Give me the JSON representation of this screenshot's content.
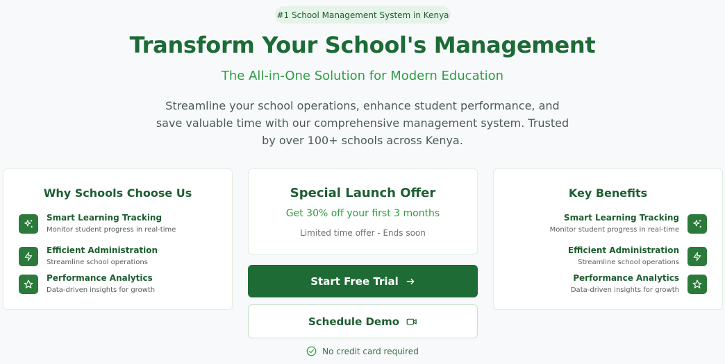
{
  "badge": "#1 School Management System in Kenya",
  "hero": {
    "title": "Transform Your School's Management",
    "subtitle": "The All-in-One Solution for Modern Education",
    "description": "Streamline your school operations, enhance student performance, and save valuable time with our comprehensive management system. Trusted by over 100+ schools across Kenya."
  },
  "why_card": {
    "title": "Why Schools Choose Us",
    "features": [
      {
        "name": "Smart Learning Tracking",
        "desc": "Monitor student progress in real-time",
        "icon": "sparkles-icon"
      },
      {
        "name": "Efficient Administration",
        "desc": "Streamline school operations",
        "icon": "lightning-icon"
      },
      {
        "name": "Performance Analytics",
        "desc": "Data-driven insights for growth",
        "icon": "star-icon"
      }
    ]
  },
  "offer_card": {
    "title": "Special Launch Offer",
    "subtitle": "Get 30% off your first 3 months",
    "note": "Limited time offer - Ends soon"
  },
  "benefits_card": {
    "title": "Key Benefits",
    "features": [
      {
        "name": "Smart Learning Tracking",
        "desc": "Monitor student progress in real-time",
        "icon": "sparkles-icon"
      },
      {
        "name": "Efficient Administration",
        "desc": "Streamline school operations",
        "icon": "lightning-icon"
      },
      {
        "name": "Performance Analytics",
        "desc": "Data-driven insights for growth",
        "icon": "star-icon"
      }
    ]
  },
  "cta": {
    "primary_label": "Start Free Trial",
    "secondary_label": "Schedule Demo",
    "no_credit_card": "No credit card required"
  },
  "colors": {
    "primary": "#1f6b36",
    "accent": "#2f9c43",
    "badge_bg": "#e6f3e8",
    "page_bg": "#f7f9fb"
  }
}
